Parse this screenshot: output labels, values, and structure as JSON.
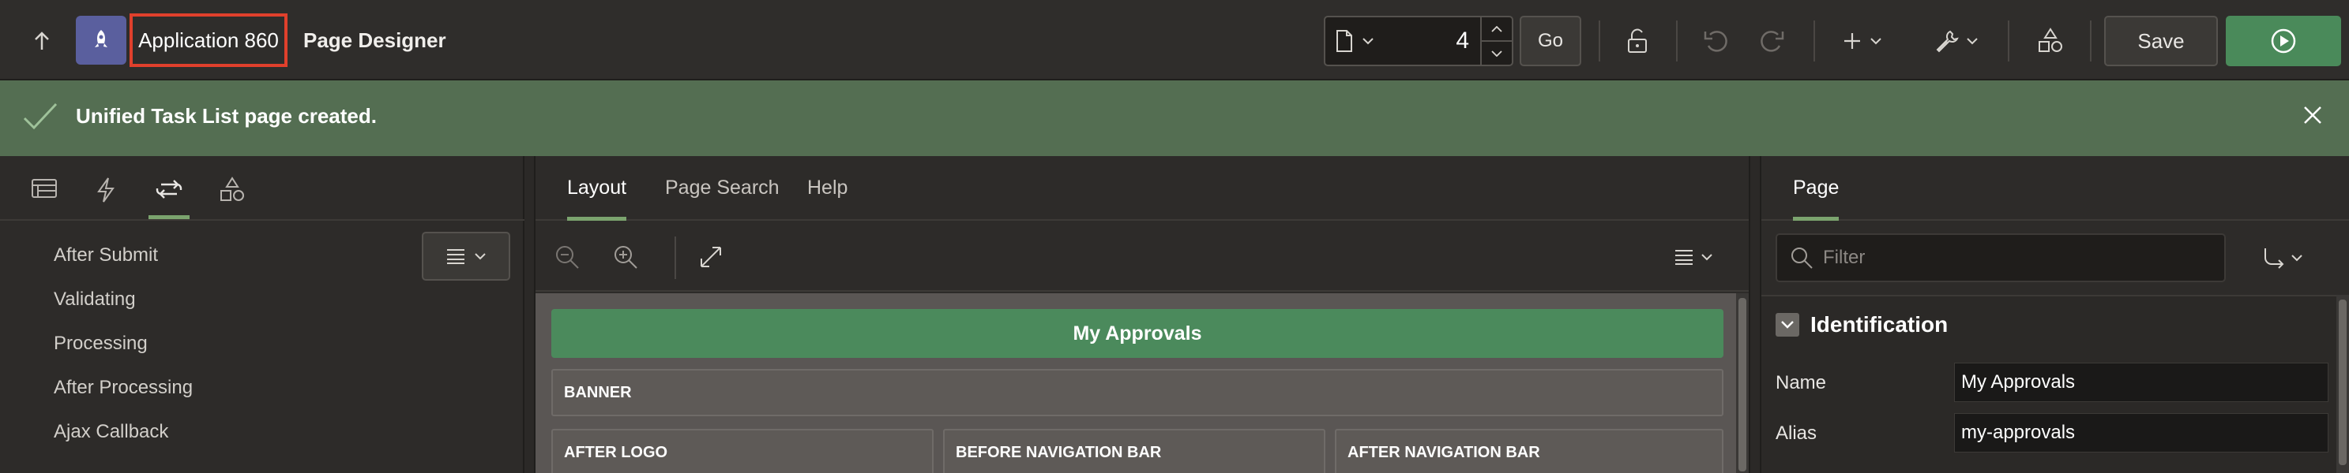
{
  "header": {
    "app_name": "Application 860",
    "title": "Page Designer",
    "page_number": "4",
    "go_label": "Go",
    "save_label": "Save"
  },
  "notification": {
    "message": "Unified Task List page created."
  },
  "left_panel": {
    "tabs": [
      "rendering",
      "dynamic-actions",
      "processing",
      "shared-components"
    ],
    "active_tab": "processing",
    "tree_items": [
      "After Submit",
      "Validating",
      "Processing",
      "After Processing",
      "Ajax Callback"
    ]
  },
  "center_panel": {
    "tabs": [
      "Layout",
      "Page Search",
      "Help"
    ],
    "active_tab": "Layout",
    "page_title_region": "My Approvals",
    "regions": {
      "banner": "BANNER",
      "after_logo": "AFTER LOGO",
      "before_nav": "BEFORE NAVIGATION BAR",
      "after_nav": "AFTER NAVIGATION BAR"
    }
  },
  "right_panel": {
    "tab": "Page",
    "filter_placeholder": "Filter",
    "group_title": "Identification",
    "properties": [
      {
        "label": "Name",
        "value": "My Approvals"
      },
      {
        "label": "Alias",
        "value": "my-approvals"
      }
    ]
  },
  "colors": {
    "accent": "#7ba46e",
    "success_banner": "#546e52",
    "run_button": "#4a8a5a",
    "highlight_box": "#e0402c"
  }
}
